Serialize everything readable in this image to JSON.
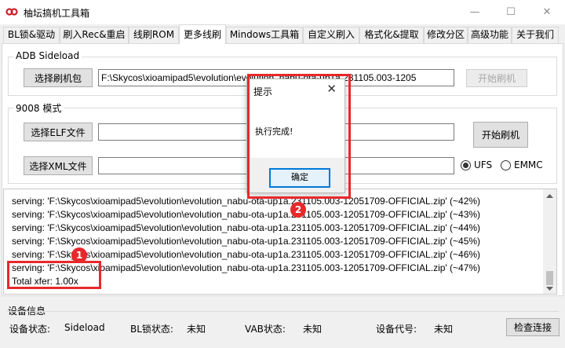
{
  "window": {
    "title": "柚坛搞机工具箱",
    "minimize_label": "—",
    "maximize_label": "☐",
    "close_label": "✕",
    "accent_color": "#cc1f2a"
  },
  "tabs": [
    {
      "label": "BL锁&驱动"
    },
    {
      "label": "刷入Rec&重启"
    },
    {
      "label": "线刷ROM"
    },
    {
      "label": "更多线刷"
    },
    {
      "label": "Mindows工具箱"
    },
    {
      "label": "自定义刷入"
    },
    {
      "label": "格式化&提取"
    },
    {
      "label": "修改分区"
    },
    {
      "label": "高级功能"
    },
    {
      "label": "关于我们"
    }
  ],
  "adb_sideload": {
    "title": "ADB Sideload",
    "select_button": "选择刷机包",
    "path_value": "F:\\Skycos\\xioamipad5\\evolution\\evolution_nabu-ota-up1a.231105.003-1205",
    "start_button": "开始刷机"
  },
  "mode_9008": {
    "title": "9008 模式",
    "select_elf_button": "选择ELF文件",
    "elf_value": "",
    "select_xml_button": "选择XML文件",
    "xml_value": "",
    "start_button": "开始刷机",
    "storage_options": [
      {
        "label": "UFS",
        "checked": true
      },
      {
        "label": "EMMC",
        "checked": false
      }
    ]
  },
  "log": {
    "lines": [
      "serving: 'F:\\Skycos\\xioamipad5\\evolution\\evolution_nabu-ota-up1a.231105.003-12051709-OFFICIAL.zip'  (~42%)",
      "serving: 'F:\\Skycos\\xioamipad5\\evolution\\evolution_nabu-ota-up1a.231105.003-12051709-OFFICIAL.zip'  (~43%)",
      "serving: 'F:\\Skycos\\xioamipad5\\evolution\\evolution_nabu-ota-up1a.231105.003-12051709-OFFICIAL.zip'  (~44%)",
      "serving: 'F:\\Skycos\\xioamipad5\\evolution\\evolution_nabu-ota-up1a.231105.003-12051709-OFFICIAL.zip'  (~45%)",
      "serving: 'F:\\Skycos\\xioamipad5\\evolution\\evolution_nabu-ota-up1a.231105.003-12051709-OFFICIAL.zip'  (~46%)",
      "serving: 'F:\\Skycos\\xioamipad5\\evolution\\evolution_nabu-ota-up1a.231105.003-12051709-OFFICIAL.zip'  (~47%)",
      "Total xfer: 1.00x"
    ]
  },
  "device_info": {
    "title": "设备信息",
    "status_label": "设备状态:",
    "status_value": "Sideload",
    "bl_label": "BL锁状态:",
    "bl_value": "未知",
    "vab_label": "VAB状态:",
    "vab_value": "未知",
    "codename_label": "设备代号:",
    "codename_value": "未知",
    "check_button": "检查连接"
  },
  "dialog": {
    "title": "提示",
    "message": "执行完成!",
    "ok_button": "确定"
  },
  "annotations": [
    {
      "badge": "1"
    },
    {
      "badge": "2"
    }
  ]
}
